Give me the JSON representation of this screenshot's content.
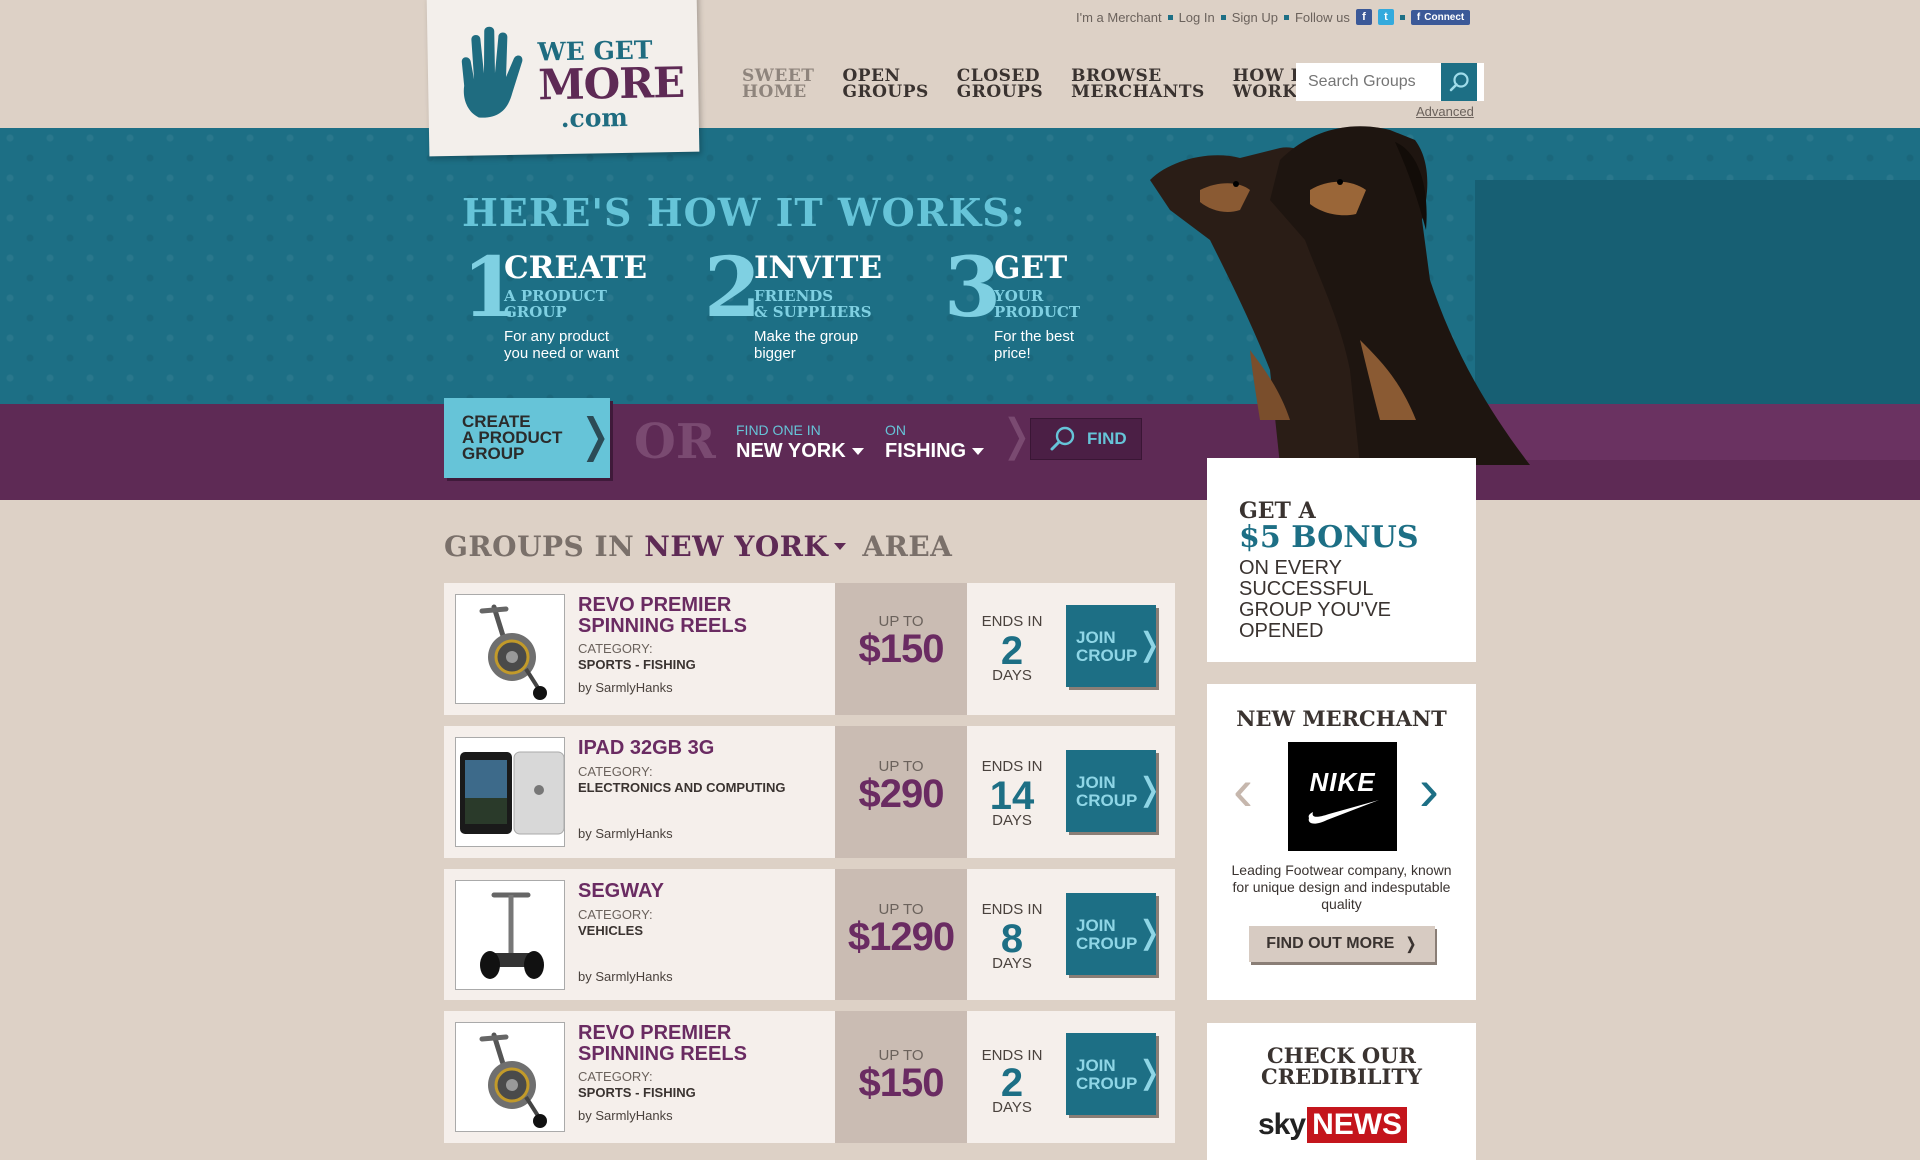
{
  "brand": {
    "logo_we_get": "WE GET",
    "logo_more": "MORE",
    "logo_com": ".com",
    "accent_teal": "#1d6f85",
    "accent_purple": "#5e2a55",
    "accent_light_teal": "#66c4d8"
  },
  "toplinks": {
    "merchant": "I'm a Merchant",
    "login": "Log In",
    "signup": "Sign Up",
    "follow": "Follow us",
    "connect": "Connect"
  },
  "nav": {
    "items": [
      {
        "line1": "SWEET",
        "line2": "HOME",
        "active": true
      },
      {
        "line1": "OPEN",
        "line2": "GROUPS",
        "active": false
      },
      {
        "line1": "CLOSED",
        "line2": "GROUPS",
        "active": false
      },
      {
        "line1": "BROWSE",
        "line2": "MERCHANTS",
        "active": false
      },
      {
        "line1": "HOW IT",
        "line2": "WORKS",
        "active": false
      }
    ]
  },
  "search": {
    "placeholder": "Search Groups",
    "advanced": "Advanced"
  },
  "hero": {
    "title": "HERE'S HOW IT WORKS:",
    "steps": [
      {
        "num": "1",
        "title": "CREATE",
        "sub1": "A PRODUCT",
        "sub2": "GROUP",
        "desc1": "For any product",
        "desc2": "you need or want"
      },
      {
        "num": "2",
        "title": "INVITE",
        "sub1": "FRIENDS",
        "sub2": "& SUPPLIERS",
        "desc1": "Make the group",
        "desc2": "bigger"
      },
      {
        "num": "3",
        "title": "GET",
        "sub1": "YOUR",
        "sub2": "PRODUCT",
        "desc1": "For the best",
        "desc2": "price!"
      }
    ]
  },
  "finder": {
    "create_line1": "CREATE",
    "create_line2": "A PRODUCT",
    "create_line3": "GROUP",
    "or": "OR",
    "find_in_label": "FIND ONE IN",
    "find_in_value": "NEW YORK",
    "on_label": "ON",
    "on_value": "FISHING",
    "find_button": "FIND"
  },
  "groups_heading": {
    "prefix": "GROUPS IN",
    "city": "NEW YORK",
    "suffix": "AREA"
  },
  "groups": [
    {
      "title1": "REVO PREMIER",
      "title2": "SPINNING REELS",
      "category_label": "CATEGORY:",
      "category": "SPORTS - FISHING",
      "by": "by SarmlyHanks",
      "upto": "UP TO",
      "price": "$150",
      "ends": "ENDS IN",
      "days_num": "2",
      "days": "DAYS",
      "join1": "JOIN",
      "join2": "CROUP",
      "image": "reel-icon"
    },
    {
      "title1": "IPAD 32GB 3G",
      "title2": "",
      "category_label": "CATEGORY:",
      "category": "ELECTRONICS AND COMPUTING",
      "by": "by SarmlyHanks",
      "upto": "UP TO",
      "price": "$290",
      "ends": "ENDS IN",
      "days_num": "14",
      "days": "DAYS",
      "join1": "JOIN",
      "join2": "CROUP",
      "image": "ipad-icon"
    },
    {
      "title1": "SEGWAY",
      "title2": "",
      "category_label": "CATEGORY:",
      "category": "VEHICLES",
      "by": "by SarmlyHanks",
      "upto": "UP TO",
      "price": "$1290",
      "ends": "ENDS IN",
      "days_num": "8",
      "days": "DAYS",
      "join1": "JOIN",
      "join2": "CROUP",
      "image": "segway-icon"
    },
    {
      "title1": "REVO PREMIER",
      "title2": "SPINNING REELS",
      "category_label": "CATEGORY:",
      "category": "SPORTS - FISHING",
      "by": "by SarmlyHanks",
      "upto": "UP TO",
      "price": "$150",
      "ends": "ENDS IN",
      "days_num": "2",
      "days": "DAYS",
      "join1": "JOIN",
      "join2": "CROUP",
      "image": "reel-icon"
    }
  ],
  "bonus": {
    "line1": "GET A",
    "line2": "$5 BONUS",
    "line3": "ON EVERY SUCCESSFUL GROUP YOU'VE OPENED"
  },
  "merchant": {
    "title": "NEW MERCHANT",
    "name": "NIKE",
    "desc": "Leading Footwear company, known for unique design and indesputable quality",
    "button": "FIND OUT MORE"
  },
  "credibility": {
    "title1": "CHECK OUR",
    "title2": "CREDIBILITY",
    "sky": "sky",
    "news": "NEWS"
  }
}
